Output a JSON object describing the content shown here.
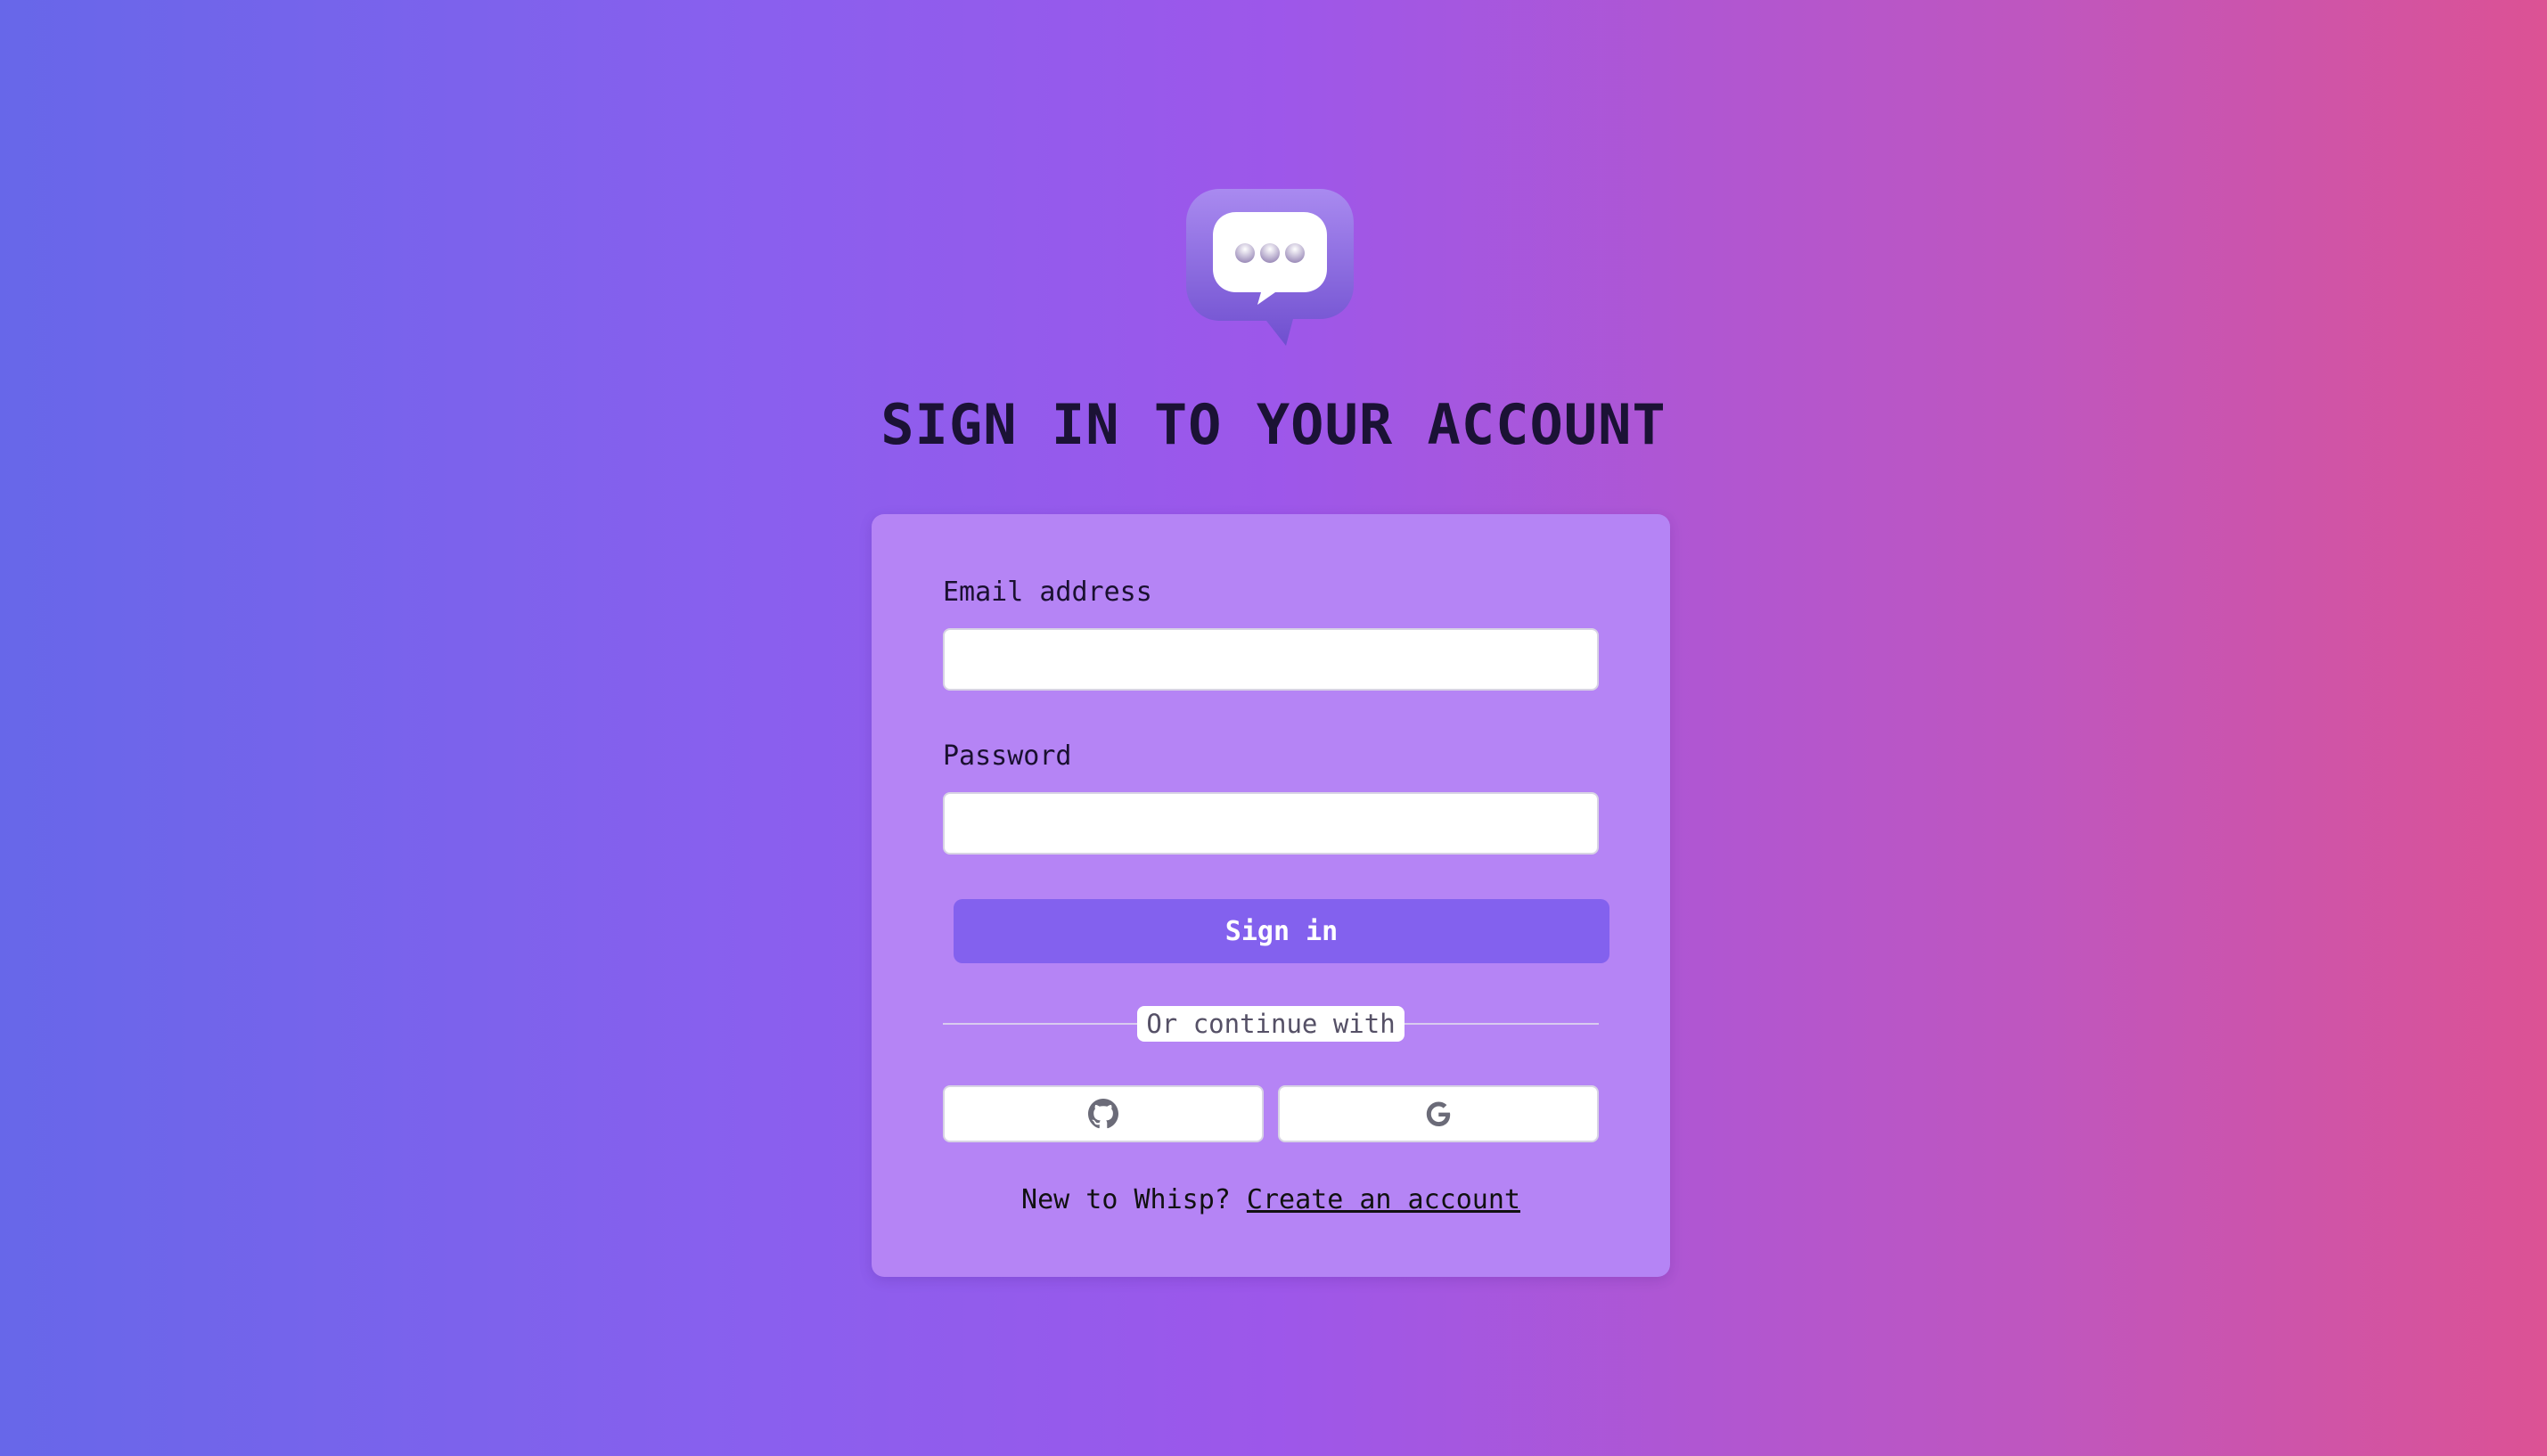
{
  "page": {
    "title": "SIGN IN TO YOUR ACCOUNT",
    "logo_icon": "chat-bubble-icon"
  },
  "form": {
    "email_label": "Email address",
    "email_value": "",
    "password_label": "Password",
    "password_value": "",
    "submit_label": "Sign in",
    "divider_text": "Or continue with",
    "oauth": [
      {
        "provider": "github",
        "icon": "github-icon"
      },
      {
        "provider": "google",
        "icon": "google-icon"
      }
    ]
  },
  "footer": {
    "prompt": "New to Whisp?",
    "link_label": "Create an account"
  },
  "colors": {
    "background_gradient": [
      "#6767e9",
      "#9d57ea",
      "#dc5294"
    ],
    "card": "#b584f5",
    "primary_button": "#8361ee",
    "title_text": "#1b1235"
  }
}
